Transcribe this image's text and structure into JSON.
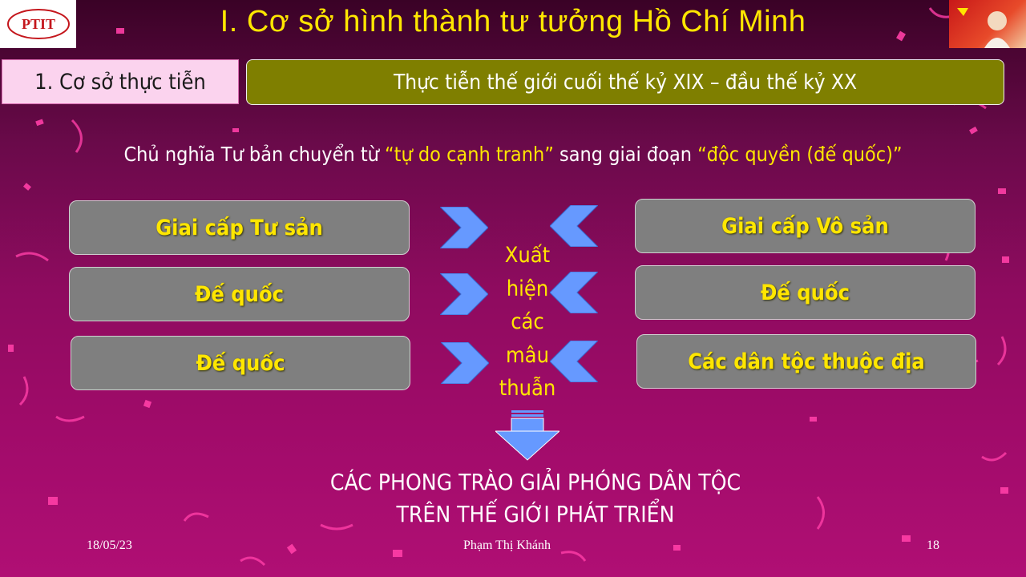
{
  "header": {
    "title": "I. Cơ sở hình thành tư tưởng Hồ Chí Minh",
    "logo_text": "PTIT"
  },
  "section": {
    "tag": "1. Cơ sở thực tiễn",
    "banner": "Thực tiễn thế giới cuối thế kỷ XIX – đầu thế kỷ XX"
  },
  "intro": {
    "prefix": "Chủ nghĩa Tư bản chuyển từ ",
    "highlight1": "“tự do cạnh tranh”",
    "middle": " sang giai đoạn ",
    "highlight2": "“độc quyền (đế quốc)”"
  },
  "left_boxes": [
    "Giai cấp Tư sản",
    "Đế quốc",
    "Đế quốc"
  ],
  "right_boxes": [
    "Giai cấp Vô sản",
    "Đế quốc",
    "Các dân tộc thuộc địa"
  ],
  "center_lines": [
    "Xuất",
    "hiện",
    "các",
    "mâu",
    "thuẫn"
  ],
  "result_lines": [
    "CÁC PHONG TRÀO GIẢI PHÓNG DÂN TỘC",
    "TRÊN THẾ GIỚI PHÁT TRIỂN"
  ],
  "footer": {
    "date": "18/05/23",
    "author": "Phạm Thị Khánh",
    "page": "18"
  },
  "colors": {
    "accent_yellow": "#ffe600",
    "box_gray": "#7f7f7f",
    "banner_olive": "#7f7f00",
    "arrow_blue": "#6699ff"
  }
}
